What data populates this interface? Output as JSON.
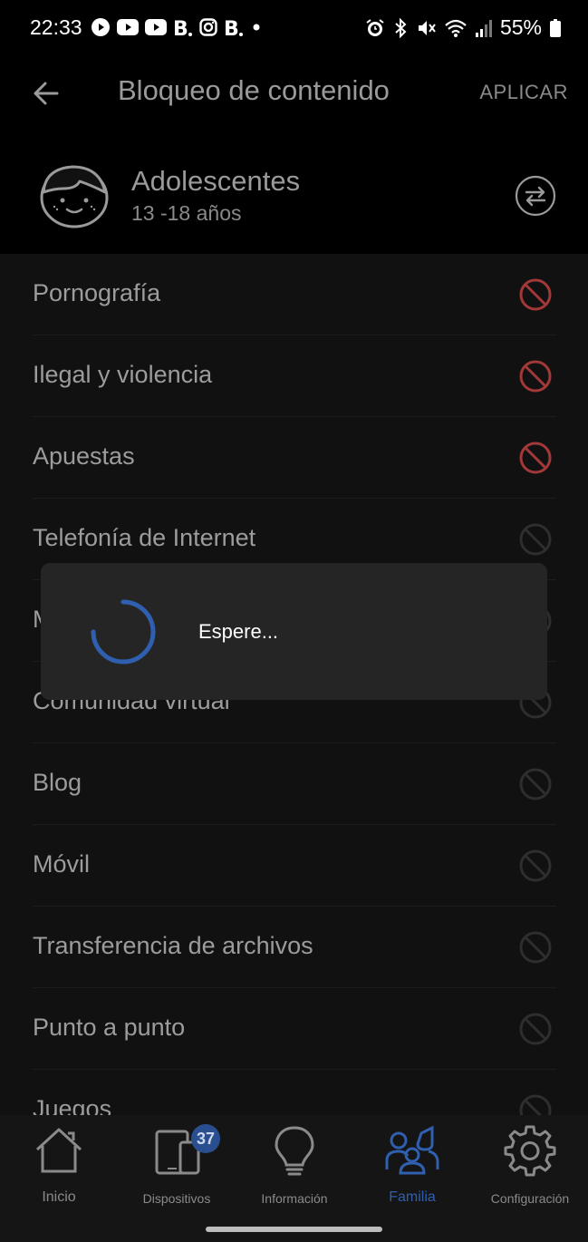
{
  "status_bar": {
    "time": "22:33",
    "battery": "55%",
    "left_icons": [
      "play-icon",
      "youtube-icon",
      "youtube-icon",
      "b-app-icon",
      "instagram-icon",
      "b-app-icon",
      "dot-icon"
    ],
    "right_icons": [
      "alarm-icon",
      "bluetooth-icon",
      "mute-icon",
      "wifi-icon",
      "signal-icon",
      "battery-icon"
    ]
  },
  "app_bar": {
    "title": "Bloqueo de contenido",
    "apply_label": "APLICAR"
  },
  "profile": {
    "name": "Adolescentes",
    "age_range": "13 -18 años"
  },
  "categories": [
    {
      "label": "Pornografía",
      "blocked": true
    },
    {
      "label": "Ilegal y violencia",
      "blocked": true
    },
    {
      "label": "Apuestas",
      "blocked": true
    },
    {
      "label": "Telefonía de Internet",
      "blocked": false
    },
    {
      "label": "M",
      "blocked": false
    },
    {
      "label": "Comunidad virtual",
      "blocked": false
    },
    {
      "label": "Blog",
      "blocked": false
    },
    {
      "label": "Móvil",
      "blocked": false
    },
    {
      "label": "Transferencia de archivos",
      "blocked": false
    },
    {
      "label": "Punto a punto",
      "blocked": false
    },
    {
      "label": "Juegos",
      "blocked": false
    }
  ],
  "dialog": {
    "message": "Espere..."
  },
  "bottom_nav": {
    "items": [
      {
        "label": "Inicio",
        "icon": "home-icon",
        "active": false
      },
      {
        "label": "Dispositivos",
        "icon": "devices-icon",
        "active": false,
        "badge": "37"
      },
      {
        "label": "Información",
        "icon": "lightbulb-icon",
        "active": false
      },
      {
        "label": "Familia",
        "icon": "family-icon",
        "active": true
      },
      {
        "label": "Configuración",
        "icon": "gear-icon",
        "active": false
      }
    ]
  },
  "colors": {
    "blocked": "#a33838",
    "unblocked": "#2e2e2e",
    "accent": "#2f5fae",
    "badge": "#2a4f90"
  }
}
